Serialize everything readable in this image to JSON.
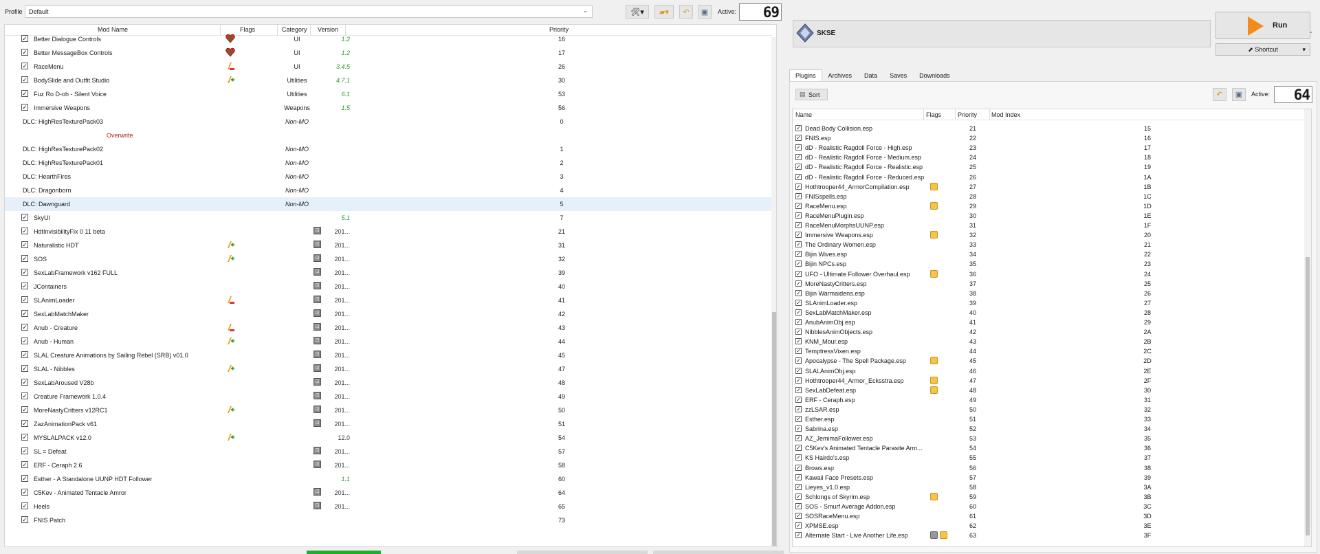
{
  "top": {
    "profile_label": "Profile",
    "profile_value": "Default",
    "active_label": "Active:",
    "active_count": "69"
  },
  "modlist": {
    "headers": {
      "name": "Mod Name",
      "flags": "Flags",
      "category": "Category",
      "version": "Version",
      "priority": "Priority"
    },
    "rows": [
      {
        "name": "Better Dialogue Controls",
        "check": true,
        "flag": "heart",
        "category": "UI",
        "version": "1.2",
        "vstyle": "g",
        "priority": "16"
      },
      {
        "name": "Better MessageBox Controls",
        "check": true,
        "flag": "heart",
        "category": "UI",
        "version": "1.2",
        "vstyle": "g",
        "priority": "17"
      },
      {
        "name": "RaceMenu",
        "check": true,
        "flag": "warn",
        "category": "UI",
        "version": "3.4.5",
        "vstyle": "g",
        "priority": "26"
      },
      {
        "name": "BodySlide and Outfit Studio",
        "check": true,
        "flag": "plus",
        "category": "Utilities",
        "version": "4.7.1",
        "vstyle": "g",
        "priority": "30"
      },
      {
        "name": "Fuz Ro D-oh - Silent Voice",
        "check": true,
        "flag": "",
        "category": "Utilities",
        "version": "6.1",
        "vstyle": "g",
        "priority": "53"
      },
      {
        "name": "Immersive Weapons",
        "check": true,
        "flag": "",
        "category": "Weapons",
        "version": "1.5",
        "vstyle": "g",
        "priority": "56"
      },
      {
        "name": "DLC: HighResTexturePack03",
        "check": null,
        "flag": "",
        "category": "Non-MO",
        "version": "",
        "vstyle": "",
        "priority": "0"
      },
      {
        "name": "Overwrite",
        "check": null,
        "flag": "",
        "category": "",
        "version": "",
        "vstyle": "",
        "priority": "",
        "special": "overwrite"
      },
      {
        "name": "DLC: HighResTexturePack02",
        "check": null,
        "flag": "",
        "category": "Non-MO",
        "version": "",
        "vstyle": "",
        "priority": "1"
      },
      {
        "name": "DLC: HighResTexturePack01",
        "check": null,
        "flag": "",
        "category": "Non-MO",
        "version": "",
        "vstyle": "",
        "priority": "2"
      },
      {
        "name": "DLC: HearthFires",
        "check": null,
        "flag": "",
        "category": "Non-MO",
        "version": "",
        "vstyle": "",
        "priority": "3"
      },
      {
        "name": "DLC: Dragonborn",
        "check": null,
        "flag": "",
        "category": "Non-MO",
        "version": "",
        "vstyle": "",
        "priority": "4"
      },
      {
        "name": "DLC: Dawnguard",
        "check": null,
        "flag": "",
        "category": "Non-MO",
        "version": "",
        "vstyle": "",
        "priority": "5",
        "selected": true
      },
      {
        "name": "SkyUI",
        "check": true,
        "flag": "",
        "category": "",
        "version": "5.1",
        "vstyle": "g",
        "priority": "7"
      },
      {
        "name": "HdtInvisibilityFix 0 11 beta",
        "check": true,
        "flag": "",
        "category": "",
        "version": "201...",
        "vstyle": "d",
        "vicon": true,
        "priority": "21"
      },
      {
        "name": "Naturalistic HDT",
        "check": true,
        "flag": "plus",
        "category": "",
        "version": "201...",
        "vstyle": "d",
        "vicon": true,
        "priority": "31"
      },
      {
        "name": "SOS",
        "check": true,
        "flag": "plus",
        "category": "",
        "version": "201...",
        "vstyle": "d",
        "vicon": true,
        "priority": "32"
      },
      {
        "name": "SexLabFramework v162 FULL",
        "check": true,
        "flag": "",
        "category": "",
        "version": "201...",
        "vstyle": "d",
        "vicon": true,
        "priority": "39"
      },
      {
        "name": "JContainers",
        "check": true,
        "flag": "",
        "category": "",
        "version": "201...",
        "vstyle": "d",
        "vicon": true,
        "priority": "40"
      },
      {
        "name": "SLAnimLoader",
        "check": true,
        "flag": "warn",
        "category": "",
        "version": "201...",
        "vstyle": "d",
        "vicon": true,
        "priority": "41"
      },
      {
        "name": "SexLabMatchMaker",
        "check": true,
        "flag": "",
        "category": "",
        "version": "201...",
        "vstyle": "d",
        "vicon": true,
        "priority": "42"
      },
      {
        "name": "Anub - Creature",
        "check": true,
        "flag": "warn",
        "category": "",
        "version": "201...",
        "vstyle": "d",
        "vicon": true,
        "priority": "43"
      },
      {
        "name": "Anub - Human",
        "check": true,
        "flag": "plus",
        "category": "",
        "version": "201...",
        "vstyle": "d",
        "vicon": true,
        "priority": "44"
      },
      {
        "name": "SLAL Creature Animations by Sailing Rebel (SRB) v01.0",
        "check": true,
        "flag": "",
        "category": "",
        "version": "201...",
        "vstyle": "d",
        "vicon": true,
        "priority": "45"
      },
      {
        "name": "SLAL - Nibbles",
        "check": true,
        "flag": "plus",
        "category": "",
        "version": "201...",
        "vstyle": "d",
        "vicon": true,
        "priority": "47"
      },
      {
        "name": "SexLabAroused V28b",
        "check": true,
        "flag": "",
        "category": "",
        "version": "201...",
        "vstyle": "d",
        "vicon": true,
        "priority": "48"
      },
      {
        "name": "Creature Framework 1.0.4",
        "check": true,
        "flag": "",
        "category": "",
        "version": "201...",
        "vstyle": "d",
        "vicon": true,
        "priority": "49"
      },
      {
        "name": "MoreNastyCritters v12RC1",
        "check": true,
        "flag": "plus",
        "category": "",
        "version": "201...",
        "vstyle": "d",
        "vicon": true,
        "priority": "50"
      },
      {
        "name": "ZazAnimationPack v61",
        "check": true,
        "flag": "",
        "category": "",
        "version": "201...",
        "vstyle": "d",
        "vicon": true,
        "priority": "51"
      },
      {
        "name": "MYSLALPACK v12.0",
        "check": true,
        "flag": "plus",
        "category": "",
        "version": "12.0",
        "vstyle": "d",
        "priority": "54"
      },
      {
        "name": "SL = Defeat",
        "check": true,
        "flag": "",
        "category": "",
        "version": "201...",
        "vstyle": "d",
        "vicon": true,
        "priority": "57"
      },
      {
        "name": "ERF - Ceraph 2.6",
        "check": true,
        "flag": "",
        "category": "",
        "version": "201...",
        "vstyle": "d",
        "vicon": true,
        "priority": "58"
      },
      {
        "name": "Esther - A Standalone UUNP HDT Follower",
        "check": true,
        "flag": "",
        "category": "",
        "version": "1.1",
        "vstyle": "g",
        "priority": "60"
      },
      {
        "name": "C5Kev - Animated Tentacle Amror",
        "check": true,
        "flag": "",
        "category": "",
        "version": "201...",
        "vstyle": "d",
        "vicon": true,
        "priority": "64"
      },
      {
        "name": "Heels",
        "check": true,
        "flag": "",
        "category": "",
        "version": "201...",
        "vstyle": "d",
        "vicon": true,
        "priority": "65"
      },
      {
        "name": "FNIS Patch",
        "check": true,
        "flag": "",
        "category": "",
        "version": "",
        "vstyle": "",
        "priority": "73"
      }
    ]
  },
  "right": {
    "executable": "SKSE",
    "run_label": "Run",
    "shortcut_label": "Shortcut",
    "tabs": [
      "Plugins",
      "Archives",
      "Data",
      "Saves",
      "Downloads"
    ],
    "active_tab": "Plugins",
    "sort_label": "Sort",
    "active_label": "Active:",
    "active_count": "64",
    "headers": {
      "name": "Name",
      "flags": "Flags",
      "priority": "Priority",
      "modindex": "Mod Index"
    },
    "plugins": [
      {
        "name": "Dead Body Collision.esp",
        "priority": "21",
        "index": "15",
        "flag": ""
      },
      {
        "name": "FNIS.esp",
        "priority": "22",
        "index": "16",
        "flag": ""
      },
      {
        "name": "dD - Realistic Ragdoll Force - High.esp",
        "priority": "23",
        "index": "17",
        "flag": ""
      },
      {
        "name": "dD - Realistic Ragdoll Force - Medium.esp",
        "priority": "24",
        "index": "18",
        "flag": ""
      },
      {
        "name": "dD - Realistic Ragdoll Force - Realistic.esp",
        "priority": "25",
        "index": "19",
        "flag": ""
      },
      {
        "name": "dD - Realistic Ragdoll Force - Reduced.esp",
        "priority": "26",
        "index": "1A",
        "flag": ""
      },
      {
        "name": "Hothtrooper44_ArmorCompilation.esp",
        "priority": "27",
        "index": "1B",
        "flag": "y"
      },
      {
        "name": "FNISspells.esp",
        "priority": "28",
        "index": "1C",
        "flag": ""
      },
      {
        "name": "RaceMenu.esp",
        "priority": "29",
        "index": "1D",
        "flag": "y"
      },
      {
        "name": "RaceMenuPlugin.esp",
        "priority": "30",
        "index": "1E",
        "flag": ""
      },
      {
        "name": "RaceMenuMorphsUUNP.esp",
        "priority": "31",
        "index": "1F",
        "flag": ""
      },
      {
        "name": "Immersive Weapons.esp",
        "priority": "32",
        "index": "20",
        "flag": "y"
      },
      {
        "name": "The Ordinary Women.esp",
        "priority": "33",
        "index": "21",
        "flag": ""
      },
      {
        "name": "Bijin Wives.esp",
        "priority": "34",
        "index": "22",
        "flag": ""
      },
      {
        "name": "Bijin NPCs.esp",
        "priority": "35",
        "index": "23",
        "flag": ""
      },
      {
        "name": "UFO - Ultimate Follower Overhaul.esp",
        "priority": "36",
        "index": "24",
        "flag": "y"
      },
      {
        "name": "MoreNastyCritters.esp",
        "priority": "37",
        "index": "25",
        "flag": ""
      },
      {
        "name": "Bijin Warmaidens.esp",
        "priority": "38",
        "index": "26",
        "flag": ""
      },
      {
        "name": "SLAnimLoader.esp",
        "priority": "39",
        "index": "27",
        "flag": ""
      },
      {
        "name": "SexLabMatchMaker.esp",
        "priority": "40",
        "index": "28",
        "flag": ""
      },
      {
        "name": "AnubAnimObj.esp",
        "priority": "41",
        "index": "29",
        "flag": ""
      },
      {
        "name": "NibblesAnimObjects.esp",
        "priority": "42",
        "index": "2A",
        "flag": ""
      },
      {
        "name": "KNM_Mour.esp",
        "priority": "43",
        "index": "2B",
        "flag": ""
      },
      {
        "name": "TemptressVixen.esp",
        "priority": "44",
        "index": "2C",
        "flag": ""
      },
      {
        "name": "Apocalypse - The Spell Package.esp",
        "priority": "45",
        "index": "2D",
        "flag": "y"
      },
      {
        "name": "SLALAnimObj.esp",
        "priority": "46",
        "index": "2E",
        "flag": ""
      },
      {
        "name": "Hothtrooper44_Armor_Ecksstra.esp",
        "priority": "47",
        "index": "2F",
        "flag": "y"
      },
      {
        "name": "SexLabDefeat.esp",
        "priority": "48",
        "index": "30",
        "flag": "y"
      },
      {
        "name": "ERF - Ceraph.esp",
        "priority": "49",
        "index": "31",
        "flag": ""
      },
      {
        "name": "zzLSAR.esp",
        "priority": "50",
        "index": "32",
        "flag": ""
      },
      {
        "name": "Esther.esp",
        "priority": "51",
        "index": "33",
        "flag": ""
      },
      {
        "name": "Sabrina.esp",
        "priority": "52",
        "index": "34",
        "flag": ""
      },
      {
        "name": "AZ_JemimaFollower.esp",
        "priority": "53",
        "index": "35",
        "flag": ""
      },
      {
        "name": "C5Kev's Animated Tentacle Parasite Arm...",
        "priority": "54",
        "index": "36",
        "flag": ""
      },
      {
        "name": "KS Hairdo's.esp",
        "priority": "55",
        "index": "37",
        "flag": ""
      },
      {
        "name": "Brows.esp",
        "priority": "56",
        "index": "38",
        "flag": ""
      },
      {
        "name": "Kawaii Face Presets.esp",
        "priority": "57",
        "index": "39",
        "flag": ""
      },
      {
        "name": "Lieyes_v1.0.esp",
        "priority": "58",
        "index": "3A",
        "flag": ""
      },
      {
        "name": "Schlongs of Skyrim.esp",
        "priority": "59",
        "index": "3B",
        "flag": "y"
      },
      {
        "name": "SOS - Smurf Average Addon.esp",
        "priority": "60",
        "index": "3C",
        "flag": ""
      },
      {
        "name": "SOSRaceMenu.esp",
        "priority": "61",
        "index": "3D",
        "flag": ""
      },
      {
        "name": "XPMSE.esp",
        "priority": "62",
        "index": "3E",
        "flag": ""
      },
      {
        "name": "Alternate Start - Live Another Life.esp",
        "priority": "63",
        "index": "3F",
        "flag": "gy"
      }
    ]
  },
  "colors": {
    "accent": "#f28c1a",
    "green": "#2c9a2c",
    "overwrite": "#b02020",
    "selected": "#e5f0fb"
  }
}
